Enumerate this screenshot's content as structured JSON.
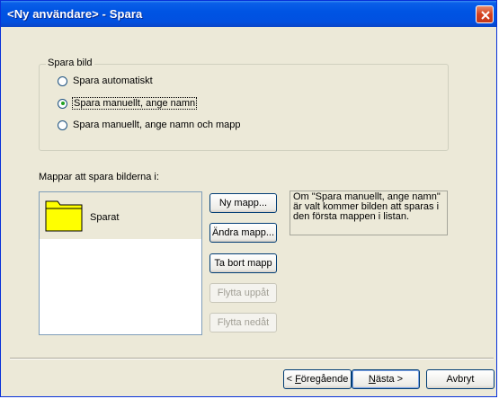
{
  "window": {
    "title": "<Ny användare> - Spara"
  },
  "save_group": {
    "legend": "Spara bild",
    "options": [
      {
        "label": "Spara automatiskt",
        "checked": false
      },
      {
        "label": "Spara manuellt, ange namn",
        "checked": true
      },
      {
        "label": "Spara manuellt, ange namn och mapp",
        "checked": false
      }
    ]
  },
  "folders": {
    "label": "Mappar att spara bilderna i:",
    "items": [
      {
        "name": "Sparat",
        "icon": "folder-icon"
      }
    ]
  },
  "folder_buttons": {
    "new": "Ny mapp...",
    "change": "Ändra mapp...",
    "delete": "Ta bort mapp",
    "move_up": "Flytta uppåt",
    "move_down": "Flytta nedåt"
  },
  "info_text": "Om \"Spara manuellt, ange namn\" är valt kommer bilden att sparas i den första mappen i listan.",
  "nav": {
    "back_prefix": "< ",
    "back_access": "F",
    "back_rest": "öregående",
    "next_access": "N",
    "next_rest": "ästa >",
    "cancel": "Avbryt"
  },
  "colors": {
    "titlebar": "#0054e3",
    "background": "#ece9d8",
    "close": "#d4411e"
  }
}
